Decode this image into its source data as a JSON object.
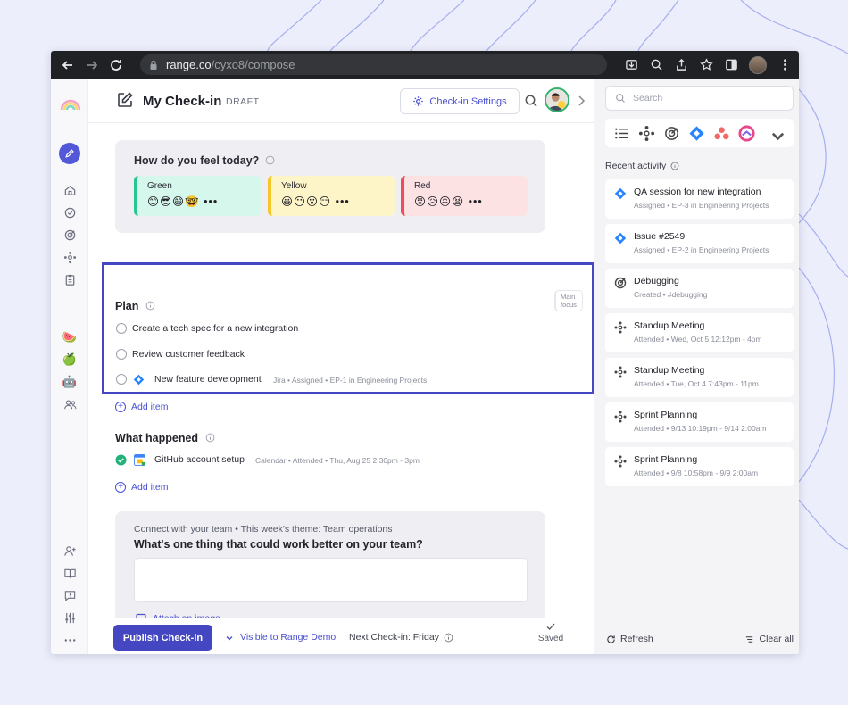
{
  "browser": {
    "url_host": "range.co",
    "url_path": "/cyxo8/compose"
  },
  "header": {
    "title": "My Check-in",
    "status": "DRAFT",
    "settings_label": "Check-in Settings"
  },
  "mood": {
    "question": "How do you feel today?",
    "options": [
      {
        "label": "Green",
        "emojis": "😊😎😄🤓 •••"
      },
      {
        "label": "Yellow",
        "emojis": "😀😐😮😑 •••"
      },
      {
        "label": "Red",
        "emojis": "😡😥😖😫 •••"
      }
    ]
  },
  "plan": {
    "title": "Plan",
    "items": [
      {
        "text": "Create a tech spec for a new integration",
        "meta": ""
      },
      {
        "text": "Review customer feedback",
        "meta": ""
      },
      {
        "text": "New feature development",
        "meta": "Jira • Assigned • EP-1 in Engineering Projects"
      }
    ],
    "add_label": "Add item",
    "main_focus": "Main focus"
  },
  "happened": {
    "title": "What happened",
    "items": [
      {
        "text": "GitHub account setup",
        "meta": "Calendar • Attended • Thu, Aug 25 2:30pm - 3pm"
      }
    ],
    "add_label": "Add item"
  },
  "prompt": {
    "subtitle": "Connect with your team • This week's theme: Team operations",
    "question": "What's one thing that could work better on your team?",
    "attach_label": "Attach an image"
  },
  "footer": {
    "publish_label": "Publish Check-in",
    "visibility_label": "Visible to Range Demo",
    "next_checkin": "Next Check-in: Friday",
    "saved_label": "Saved"
  },
  "sidebar_right": {
    "search_placeholder": "Search",
    "recent_title": "Recent activity",
    "activities": [
      {
        "icon": "jira-icon",
        "title": "QA session for new integration",
        "sub": "Assigned • EP-3 in Engineering Projects"
      },
      {
        "icon": "jira-icon",
        "title": "Issue #2549",
        "sub": "Assigned • EP-2 in Engineering Projects"
      },
      {
        "icon": "target-icon",
        "title": "Debugging",
        "sub": "Created • #debugging"
      },
      {
        "icon": "meeting-icon",
        "title": "Standup Meeting",
        "sub": "Attended • Wed, Oct 5 12:12pm - 4pm"
      },
      {
        "icon": "meeting-icon",
        "title": "Standup Meeting",
        "sub": "Attended • Tue, Oct 4 7:43pm - 11pm"
      },
      {
        "icon": "meeting-icon",
        "title": "Sprint Planning",
        "sub": "Attended • 9/13 10:19pm - 9/14 2:00am"
      },
      {
        "icon": "meeting-icon",
        "title": "Sprint Planning",
        "sub": "Attended • 9/8 10:58pm - 9/9 2:00am"
      }
    ],
    "refresh_label": "Refresh",
    "clear_label": "Clear all"
  },
  "colors": {
    "accent": "#4446c2",
    "green": "#27c590",
    "yellow": "#f4c62a",
    "red": "#ee4c5d",
    "jira": "#2684ff"
  }
}
